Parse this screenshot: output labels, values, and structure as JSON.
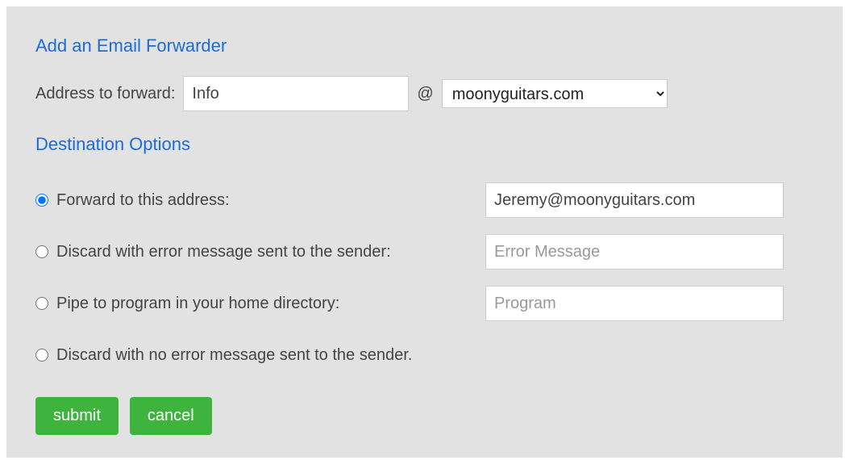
{
  "titles": {
    "add_forwarder": "Add an Email Forwarder",
    "destination_options": "Destination Options"
  },
  "address": {
    "label": "Address to forward:",
    "value": "Info",
    "at": "@",
    "domain": "moonyguitars.com"
  },
  "options": {
    "forward": {
      "label": "Forward to this address:",
      "value": "Jeremy@moonyguitars.com",
      "selected": true
    },
    "discard_error": {
      "label": "Discard with error message sent to the sender:",
      "value": "",
      "placeholder": "Error Message",
      "selected": false
    },
    "pipe": {
      "label": "Pipe to program in your home directory:",
      "value": "",
      "placeholder": "Program",
      "selected": false
    },
    "discard_silent": {
      "label": "Discard with no error message sent to the sender.",
      "selected": false
    }
  },
  "buttons": {
    "submit": "submit",
    "cancel": "cancel"
  }
}
